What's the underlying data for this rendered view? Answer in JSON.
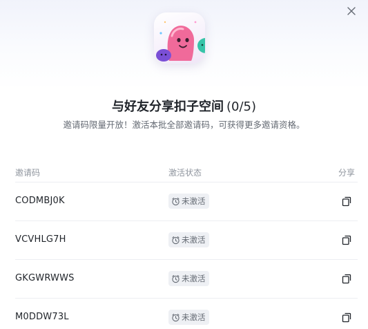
{
  "dialog": {
    "title": "与好友分享扣子空间",
    "invite_count": "(0/5)",
    "subtitle": "邀请码限量开放！激活本批全部邀请码，可获得更多邀请资格。"
  },
  "table": {
    "headers": {
      "code": "邀请码",
      "status": "激活状态",
      "share": "分享"
    },
    "rows": [
      {
        "code": "CODMBJ0K",
        "status": "未激活"
      },
      {
        "code": "VCVHLG7H",
        "status": "未激活"
      },
      {
        "code": "GKGWRWWS",
        "status": "未激活"
      },
      {
        "code": "M0DDW73L",
        "status": "未激活"
      }
    ]
  },
  "icons": {
    "close": "close-icon",
    "status": "clock-icon",
    "share": "copy-icon"
  },
  "colors": {
    "title": "#1f2329",
    "muted": "#646a73",
    "badge_bg": "#eef0f4"
  }
}
